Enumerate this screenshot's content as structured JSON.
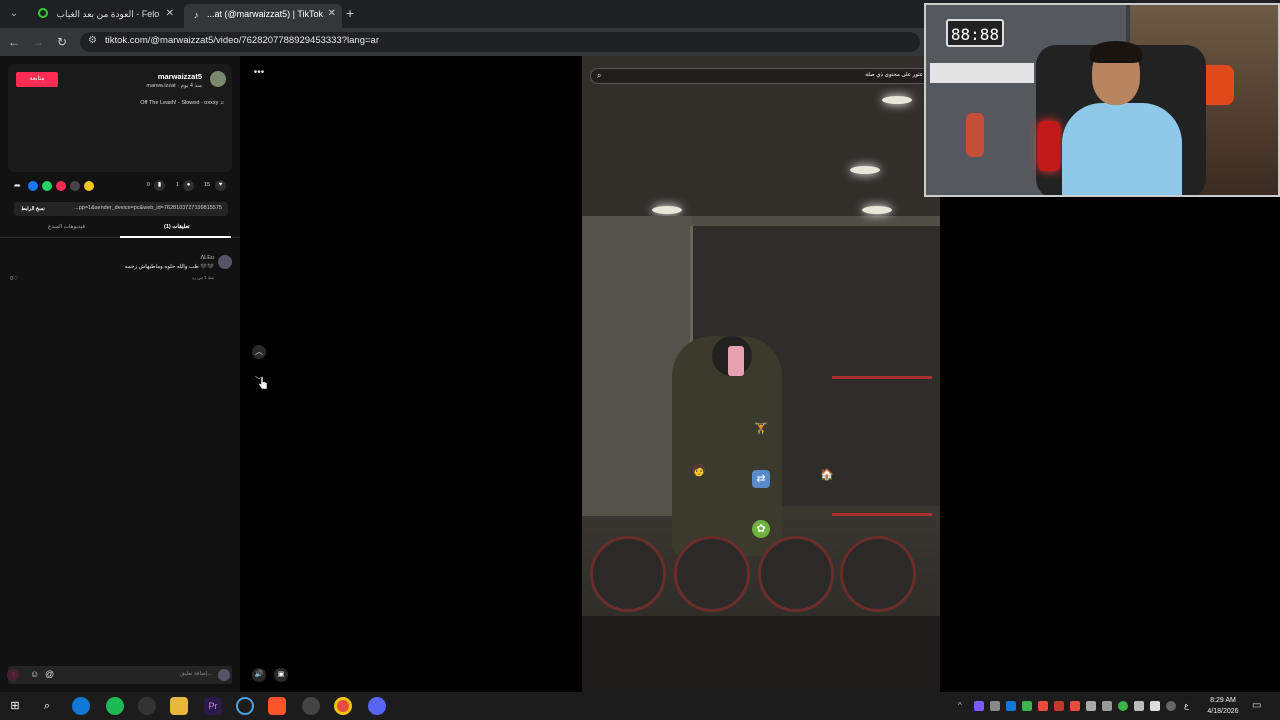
{
  "browser": {
    "tabs": [
      {
        "label": "العودة من بعد الغياب - Felo",
        "active": false
      },
      {
        "label": "...at (@marwaizzat5) | TikTok",
        "active": true
      }
    ],
    "url": "tiktok.com/@marwaizzat5/video/7628207788929453333?lang=ar"
  },
  "post": {
    "follow_label": "متابعة",
    "username": "marwaizzat5",
    "subtitle": "marwa.izzat · منذ 4 يوم",
    "music": "Off The Leash! - Slowed - oxxxy ♫",
    "stats": {
      "likes": "15",
      "comments": "1",
      "saves": "0"
    },
    "link_text": "...pp=1&sender_device=pc&web_id=7628103727199815575",
    "copy_label": "نسخ الرابط",
    "tab_comments": "(1) تعليقات",
    "tab_creator": "فيديوهات المبدع"
  },
  "comment": {
    "name": "ΛLEʊ",
    "text": "طب والله حلوه وماطيهاش زحمه 🖤🖤",
    "meta": "منذ 1 س   رد",
    "likes": "0"
  },
  "comment_input": {
    "placeholder": "إضافة تعليق...",
    "at_icon": "@",
    "emoji_icon": "☺"
  },
  "video": {
    "search_text": "عثور على محتوى ذي صلة"
  },
  "webcam": {
    "clock": "88:88"
  },
  "taskbar": {
    "time": "8:29 AM",
    "date": "4/18/2026",
    "lang": "ع"
  },
  "colors": {
    "accent": "#fe2c55",
    "panel": "#121212",
    "chrome": "#35363a"
  }
}
